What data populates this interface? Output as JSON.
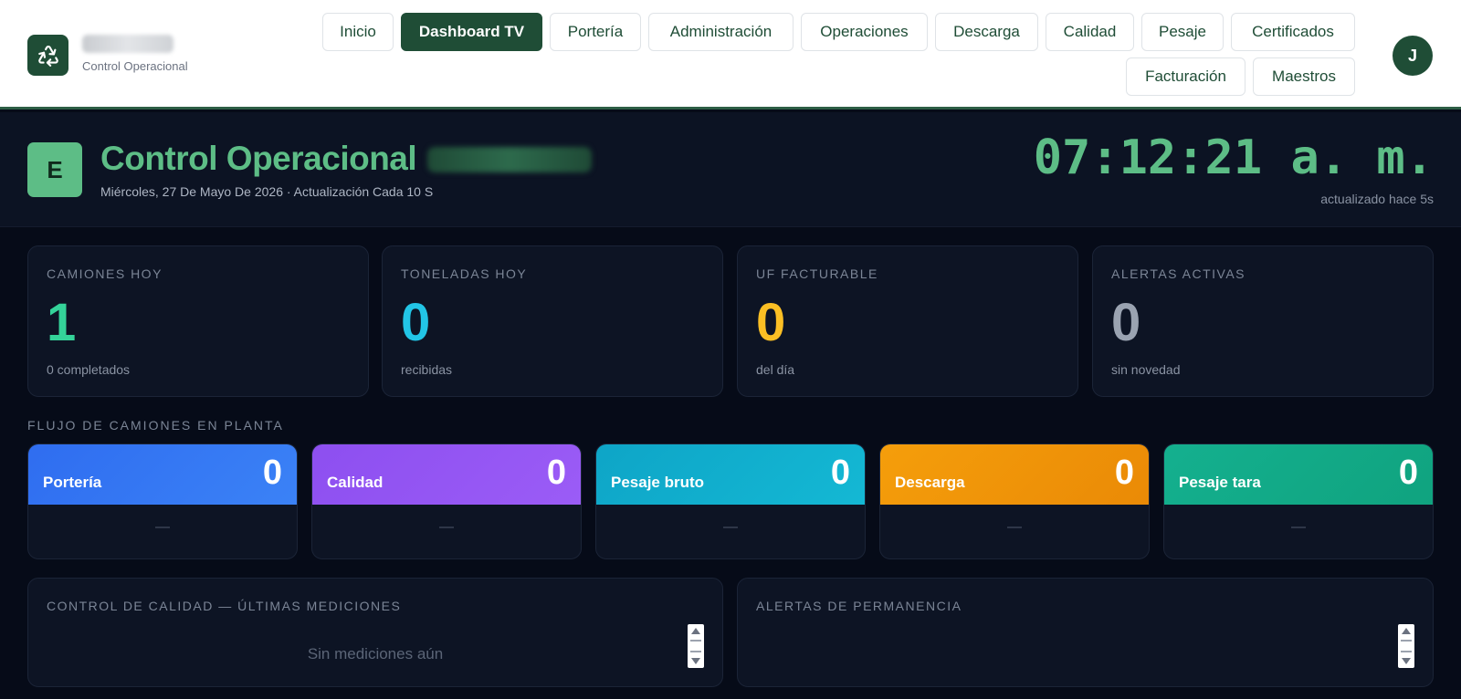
{
  "topbar": {
    "brand_sub": "Control Operacional",
    "nav": [
      {
        "label": "Inicio",
        "active": false
      },
      {
        "label": "Dashboard TV",
        "active": true
      },
      {
        "label": "Portería",
        "active": false
      },
      {
        "label": "Administración",
        "active": false
      },
      {
        "label": "Operaciones",
        "active": false
      },
      {
        "label": "Descarga",
        "active": false
      },
      {
        "label": "Calidad",
        "active": false
      },
      {
        "label": "Pesaje",
        "active": false
      },
      {
        "label": "Certificados",
        "active": false
      },
      {
        "label": "Facturación",
        "active": false
      },
      {
        "label": "Maestros",
        "active": false
      }
    ],
    "avatar_initial": "J"
  },
  "header": {
    "badge_letter": "E",
    "title": "Control Operacional",
    "subtitle": "Miércoles, 27 De Mayo De 2026 · Actualización Cada 10 S",
    "clock": "07:12:21 a. m.",
    "updated": "actualizado hace 5s"
  },
  "kpis": [
    {
      "label": "CAMIONES HOY",
      "value": "1",
      "sub": "0 completados",
      "color": "#34d399"
    },
    {
      "label": "TONELADAS HOY",
      "value": "0",
      "sub": "recibidas",
      "color": "#22c5e6"
    },
    {
      "label": "UF FACTURABLE",
      "value": "0",
      "sub": "del día",
      "color": "#fbbf24"
    },
    {
      "label": "ALERTAS ACTIVAS",
      "value": "0",
      "sub": "sin novedad",
      "color": "#9aa3b1"
    }
  ],
  "flow": {
    "title": "FLUJO DE CAMIONES EN PLANTA",
    "stages": [
      {
        "name": "Portería",
        "count": "0",
        "detail": "—",
        "color_from": "#2f6df0",
        "color_to": "#3b82f6"
      },
      {
        "name": "Calidad",
        "count": "0",
        "detail": "—",
        "color_from": "#8d4ff0",
        "color_to": "#9b5cf6"
      },
      {
        "name": "Pesaje bruto",
        "count": "0",
        "detail": "—",
        "color_from": "#0ea5c7",
        "color_to": "#14b8d4"
      },
      {
        "name": "Descarga",
        "count": "0",
        "detail": "—",
        "color_from": "#f59e0b",
        "color_to": "#ea8a06"
      },
      {
        "name": "Pesaje tara",
        "count": "0",
        "detail": "—",
        "color_from": "#14b08f",
        "color_to": "#10a37f"
      }
    ]
  },
  "panels": {
    "quality": {
      "title": "CONTROL DE CALIDAD — ÚLTIMAS MEDICIONES",
      "empty": "Sin mediciones aún"
    },
    "alerts": {
      "title": "ALERTAS DE PERMANENCIA"
    }
  }
}
